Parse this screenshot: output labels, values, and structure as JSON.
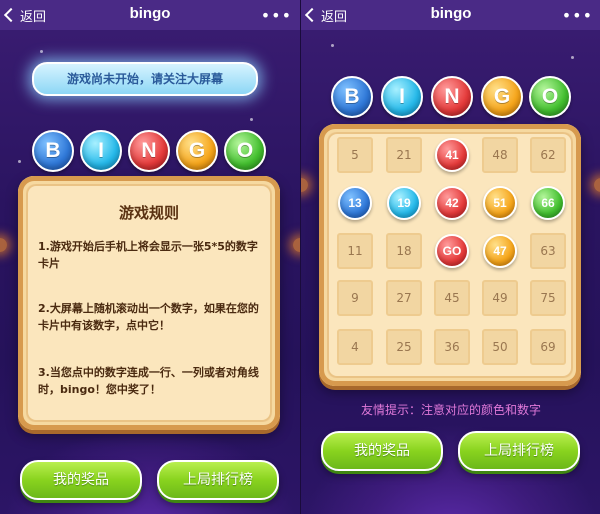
{
  "navbar": {
    "back_label": "返回",
    "title": "bingo",
    "more_label": "•••"
  },
  "left": {
    "banner": "游戏尚未开始，请关注大屏幕",
    "letters": [
      "B",
      "I",
      "N",
      "G",
      "O"
    ],
    "rules": {
      "title": "游戏规则",
      "items": [
        "1.游戏开始后手机上将会显示一张5*5的数字卡片",
        "2.大屏幕上随机滚动出一个数字，如果在您的卡片中有该数字，点中它！",
        "3.当您点中的数字连成一行、一列或者对角线时，bingo！您中奖了！"
      ]
    },
    "buttons": {
      "prizes": "我的奖品",
      "ranking": "上局排行榜"
    }
  },
  "right": {
    "letters": [
      "B",
      "I",
      "N",
      "G",
      "O"
    ],
    "grid": [
      [
        {
          "v": "5"
        },
        {
          "v": "21"
        },
        {
          "v": "41",
          "m": "red"
        },
        {
          "v": "48"
        },
        {
          "v": "62"
        }
      ],
      [
        {
          "v": "13",
          "m": "blue"
        },
        {
          "v": "19",
          "m": "cyan"
        },
        {
          "v": "42",
          "m": "red"
        },
        {
          "v": "51",
          "m": "orange"
        },
        {
          "v": "66",
          "m": "green"
        }
      ],
      [
        {
          "v": "11"
        },
        {
          "v": "18"
        },
        {
          "v": "GO",
          "m": "red"
        },
        {
          "v": "47",
          "m": "orange"
        },
        {
          "v": "63"
        }
      ],
      [
        {
          "v": "9"
        },
        {
          "v": "27"
        },
        {
          "v": "45"
        },
        {
          "v": "49"
        },
        {
          "v": "75"
        }
      ],
      [
        {
          "v": "4"
        },
        {
          "v": "25"
        },
        {
          "v": "36"
        },
        {
          "v": "50"
        },
        {
          "v": "69"
        }
      ]
    ],
    "hint": "友情提示：注意对应的颜色和数字",
    "buttons": {
      "prizes": "我的奖品",
      "ranking": "上局排行榜"
    }
  },
  "colors": {
    "blue": "#2f78d8",
    "cyan": "#25b9ea",
    "red": "#e53a3a",
    "orange": "#f6a51a",
    "green": "#43c02f",
    "button_green": "#89d31e"
  },
  "icons": {
    "back": "chevron-left-icon",
    "more": "more-dots-icon"
  }
}
